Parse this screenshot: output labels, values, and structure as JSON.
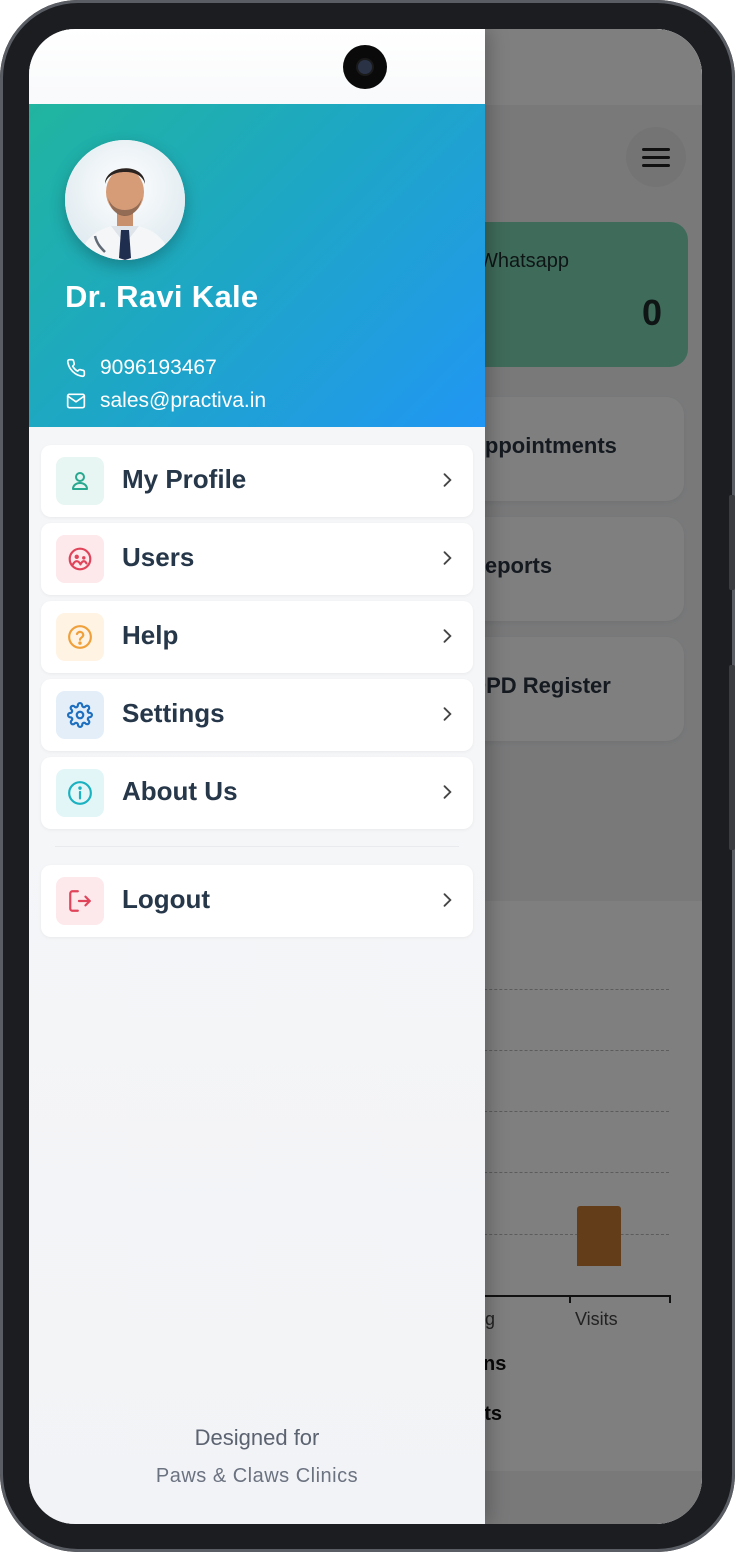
{
  "background_app": {
    "whatsapp_card": {
      "label": "Whatsapp",
      "count": "0"
    },
    "cards": [
      "Appointments",
      "Reports",
      "OPD Register"
    ],
    "chart_data": {
      "type": "bar",
      "categories": [
        "Pending",
        "Visits"
      ],
      "values": [
        0,
        1
      ],
      "xlabel": "",
      "ylabel": ""
    },
    "legend": [
      "Admins",
      "Visits"
    ]
  },
  "drawer": {
    "profile": {
      "name": "Dr. Ravi Kale",
      "phone": "9096193467",
      "email": "sales@practiva.in"
    },
    "menu_items": [
      {
        "label": "My Profile",
        "icon": "user-icon",
        "color": "#27a88f",
        "bg": "#e7f6f2"
      },
      {
        "label": "Users",
        "icon": "users-icon",
        "color": "#e0445a",
        "bg": "#fde8eb"
      },
      {
        "label": "Help",
        "icon": "help-icon",
        "color": "#f0a03a",
        "bg": "#fff3e3"
      },
      {
        "label": "Settings",
        "icon": "gear-icon",
        "color": "#1e6fbf",
        "bg": "#e3eef9"
      },
      {
        "label": "About Us",
        "icon": "info-icon",
        "color": "#1ab1c0",
        "bg": "#e2f6f8"
      }
    ],
    "logout": {
      "label": "Logout",
      "icon": "logout-icon",
      "color": "#e0445a",
      "bg": "#fde8eb"
    },
    "footer": {
      "line1": "Designed for",
      "line2": "Paws & Claws Clinics"
    }
  },
  "colors": {
    "header_start": "#20b59f",
    "header_end": "#2196f3",
    "menu_text": "#26374a"
  }
}
